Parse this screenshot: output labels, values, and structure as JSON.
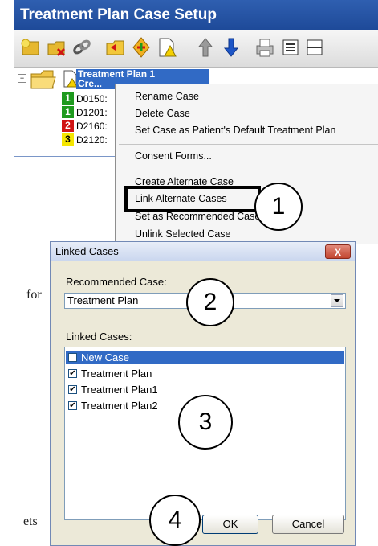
{
  "panel": {
    "title": "Treatment Plan Case Setup",
    "case_name": "Treatment Plan 1",
    "case_created": "Cre..."
  },
  "toolbar": {
    "icons": [
      "new-case-icon",
      "delete-case-icon",
      "link-icon",
      "open-folder-icon",
      "move-icon",
      "document-warning-icon",
      "arrow-up-icon",
      "arrow-down-icon",
      "print-icon",
      "list-icon",
      "collapse-icon"
    ]
  },
  "tree": {
    "rows": [
      {
        "num": "1",
        "code": "D0150:",
        "color": "#1e9a1e",
        "text_color": "#ffffff"
      },
      {
        "num": "1",
        "code": "D1201:",
        "color": "#1e9a1e",
        "text_color": "#ffffff"
      },
      {
        "num": "2",
        "code": "D2160:",
        "color": "#d01414",
        "text_color": "#ffffff"
      },
      {
        "num": "3",
        "code": "D2120:",
        "color": "#f5e600",
        "text_color": "#000000"
      }
    ]
  },
  "context_menu": {
    "items": [
      "Rename Case",
      "Delete Case",
      "Set Case as Patient's Default Treatment Plan",
      "Consent Forms...",
      "Create Alternate Case",
      "Link Alternate Cases",
      "Set as Recommended Case",
      "Unlink Selected Case"
    ]
  },
  "dialog": {
    "title": "Linked Cases",
    "close_label": "X",
    "recommended_label": "Recommended Case:",
    "recommended_value": "Treatment Plan",
    "linked_label": "Linked Cases:",
    "items": [
      {
        "label": "New Case",
        "checked": false,
        "selected": true
      },
      {
        "label": "Treatment Plan",
        "checked": true,
        "selected": false
      },
      {
        "label": "Treatment Plan1",
        "checked": true,
        "selected": false
      },
      {
        "label": "Treatment Plan2",
        "checked": true,
        "selected": false
      }
    ],
    "ok_label": "OK",
    "cancel_label": "Cancel"
  },
  "callouts": [
    "1",
    "2",
    "3",
    "4"
  ],
  "background_text": {
    "fragment_1": "for",
    "fragment_2": "ets"
  },
  "colors": {
    "title_bar": "#1e4a99",
    "selection": "#316ac5"
  }
}
